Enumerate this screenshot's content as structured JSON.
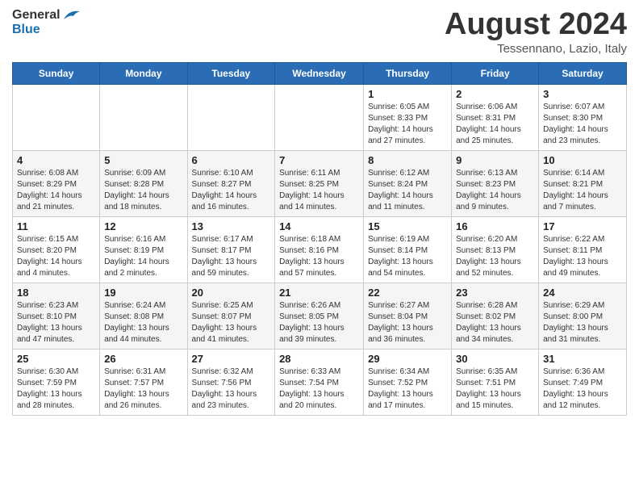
{
  "header": {
    "logo_general": "General",
    "logo_blue": "Blue",
    "month_year": "August 2024",
    "location": "Tessennano, Lazio, Italy"
  },
  "weekdays": [
    "Sunday",
    "Monday",
    "Tuesday",
    "Wednesday",
    "Thursday",
    "Friday",
    "Saturday"
  ],
  "weeks": [
    [
      {
        "day": "",
        "info": ""
      },
      {
        "day": "",
        "info": ""
      },
      {
        "day": "",
        "info": ""
      },
      {
        "day": "",
        "info": ""
      },
      {
        "day": "1",
        "info": "Sunrise: 6:05 AM\nSunset: 8:33 PM\nDaylight: 14 hours\nand 27 minutes."
      },
      {
        "day": "2",
        "info": "Sunrise: 6:06 AM\nSunset: 8:31 PM\nDaylight: 14 hours\nand 25 minutes."
      },
      {
        "day": "3",
        "info": "Sunrise: 6:07 AM\nSunset: 8:30 PM\nDaylight: 14 hours\nand 23 minutes."
      }
    ],
    [
      {
        "day": "4",
        "info": "Sunrise: 6:08 AM\nSunset: 8:29 PM\nDaylight: 14 hours\nand 21 minutes."
      },
      {
        "day": "5",
        "info": "Sunrise: 6:09 AM\nSunset: 8:28 PM\nDaylight: 14 hours\nand 18 minutes."
      },
      {
        "day": "6",
        "info": "Sunrise: 6:10 AM\nSunset: 8:27 PM\nDaylight: 14 hours\nand 16 minutes."
      },
      {
        "day": "7",
        "info": "Sunrise: 6:11 AM\nSunset: 8:25 PM\nDaylight: 14 hours\nand 14 minutes."
      },
      {
        "day": "8",
        "info": "Sunrise: 6:12 AM\nSunset: 8:24 PM\nDaylight: 14 hours\nand 11 minutes."
      },
      {
        "day": "9",
        "info": "Sunrise: 6:13 AM\nSunset: 8:23 PM\nDaylight: 14 hours\nand 9 minutes."
      },
      {
        "day": "10",
        "info": "Sunrise: 6:14 AM\nSunset: 8:21 PM\nDaylight: 14 hours\nand 7 minutes."
      }
    ],
    [
      {
        "day": "11",
        "info": "Sunrise: 6:15 AM\nSunset: 8:20 PM\nDaylight: 14 hours\nand 4 minutes."
      },
      {
        "day": "12",
        "info": "Sunrise: 6:16 AM\nSunset: 8:19 PM\nDaylight: 14 hours\nand 2 minutes."
      },
      {
        "day": "13",
        "info": "Sunrise: 6:17 AM\nSunset: 8:17 PM\nDaylight: 13 hours\nand 59 minutes."
      },
      {
        "day": "14",
        "info": "Sunrise: 6:18 AM\nSunset: 8:16 PM\nDaylight: 13 hours\nand 57 minutes."
      },
      {
        "day": "15",
        "info": "Sunrise: 6:19 AM\nSunset: 8:14 PM\nDaylight: 13 hours\nand 54 minutes."
      },
      {
        "day": "16",
        "info": "Sunrise: 6:20 AM\nSunset: 8:13 PM\nDaylight: 13 hours\nand 52 minutes."
      },
      {
        "day": "17",
        "info": "Sunrise: 6:22 AM\nSunset: 8:11 PM\nDaylight: 13 hours\nand 49 minutes."
      }
    ],
    [
      {
        "day": "18",
        "info": "Sunrise: 6:23 AM\nSunset: 8:10 PM\nDaylight: 13 hours\nand 47 minutes."
      },
      {
        "day": "19",
        "info": "Sunrise: 6:24 AM\nSunset: 8:08 PM\nDaylight: 13 hours\nand 44 minutes."
      },
      {
        "day": "20",
        "info": "Sunrise: 6:25 AM\nSunset: 8:07 PM\nDaylight: 13 hours\nand 41 minutes."
      },
      {
        "day": "21",
        "info": "Sunrise: 6:26 AM\nSunset: 8:05 PM\nDaylight: 13 hours\nand 39 minutes."
      },
      {
        "day": "22",
        "info": "Sunrise: 6:27 AM\nSunset: 8:04 PM\nDaylight: 13 hours\nand 36 minutes."
      },
      {
        "day": "23",
        "info": "Sunrise: 6:28 AM\nSunset: 8:02 PM\nDaylight: 13 hours\nand 34 minutes."
      },
      {
        "day": "24",
        "info": "Sunrise: 6:29 AM\nSunset: 8:00 PM\nDaylight: 13 hours\nand 31 minutes."
      }
    ],
    [
      {
        "day": "25",
        "info": "Sunrise: 6:30 AM\nSunset: 7:59 PM\nDaylight: 13 hours\nand 28 minutes."
      },
      {
        "day": "26",
        "info": "Sunrise: 6:31 AM\nSunset: 7:57 PM\nDaylight: 13 hours\nand 26 minutes."
      },
      {
        "day": "27",
        "info": "Sunrise: 6:32 AM\nSunset: 7:56 PM\nDaylight: 13 hours\nand 23 minutes."
      },
      {
        "day": "28",
        "info": "Sunrise: 6:33 AM\nSunset: 7:54 PM\nDaylight: 13 hours\nand 20 minutes."
      },
      {
        "day": "29",
        "info": "Sunrise: 6:34 AM\nSunset: 7:52 PM\nDaylight: 13 hours\nand 17 minutes."
      },
      {
        "day": "30",
        "info": "Sunrise: 6:35 AM\nSunset: 7:51 PM\nDaylight: 13 hours\nand 15 minutes."
      },
      {
        "day": "31",
        "info": "Sunrise: 6:36 AM\nSunset: 7:49 PM\nDaylight: 13 hours\nand 12 minutes."
      }
    ]
  ]
}
